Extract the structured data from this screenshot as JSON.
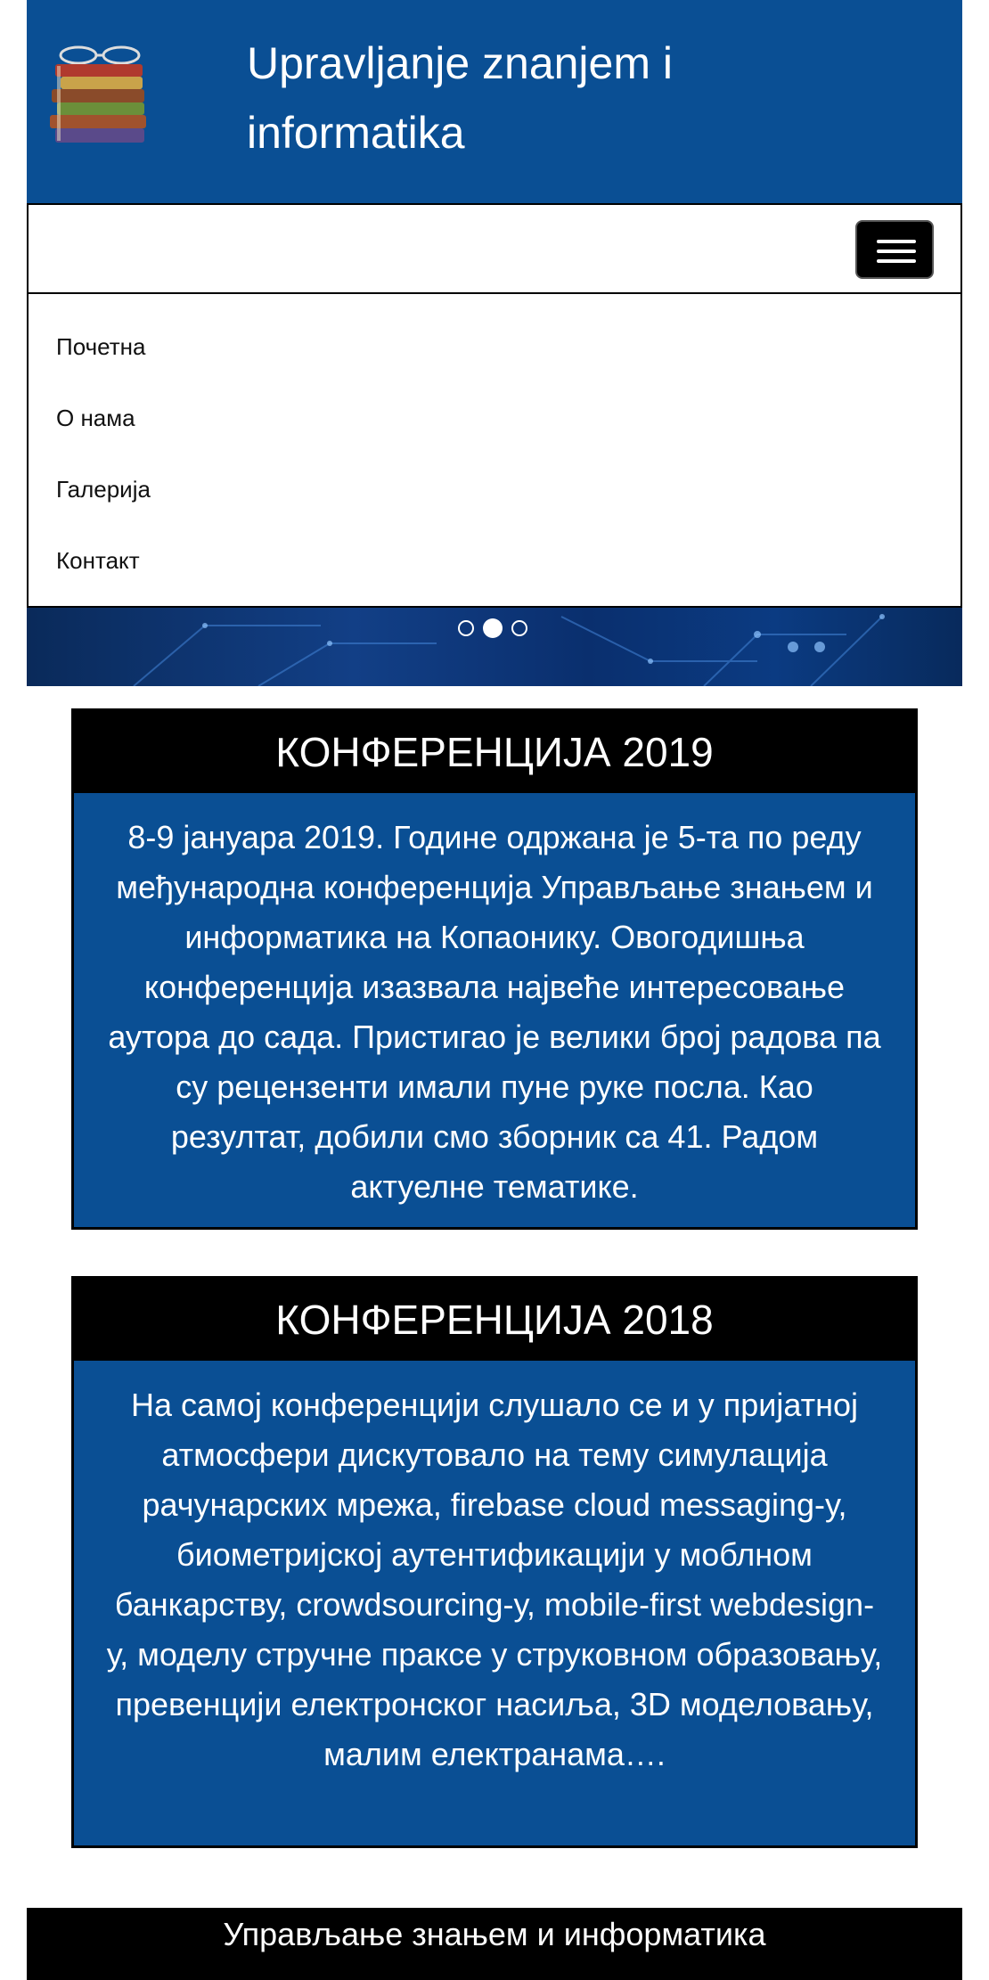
{
  "header": {
    "title": "Upravljanje znanjem i informatika",
    "logo_caption": "Upravljanje znanjem"
  },
  "nav": {
    "toggler_icon": "hamburger-icon",
    "items": [
      {
        "label": "Почетна"
      },
      {
        "label": "О нама"
      },
      {
        "label": "Галерија"
      },
      {
        "label": "Контакт"
      }
    ]
  },
  "carousel": {
    "slide_count": 3,
    "active_index": 1
  },
  "cards": [
    {
      "title": "КОНФЕРЕНЦИЈА 2019",
      "body": "8-9 јануара 2019. Године одржана је 5-та по реду међународна конференција Управљање знањем и информатика на Копаонику. Овогодишња конференција изазвала највеће интересовање аутора до сада. Пристигао је велики број радова па су рецензенти имали пуне руке посла. Као резултат, добили смо зборник са 41. Радом актуелне тематике."
    },
    {
      "title": "КОНФЕРЕНЦИЈА 2018",
      "body": "На самој конференцији слушало се и у пријатној атмосфери дискутовало на тему симулација рачунарских мрежа, firebase cloud messaging-у, биометријској аутентификацији у моблном банкарству, crowdsourcing-у, mobile-first webdesign-у, моделу стручне праксе у струковном образовању, превенцији електронског насиља, 3D моделовању, малим електранама…."
    }
  ],
  "footer": {
    "text": "Управљање знањем и информатика"
  },
  "colors": {
    "brand_blue": "#0a4f94",
    "black": "#000000",
    "white": "#ffffff"
  }
}
